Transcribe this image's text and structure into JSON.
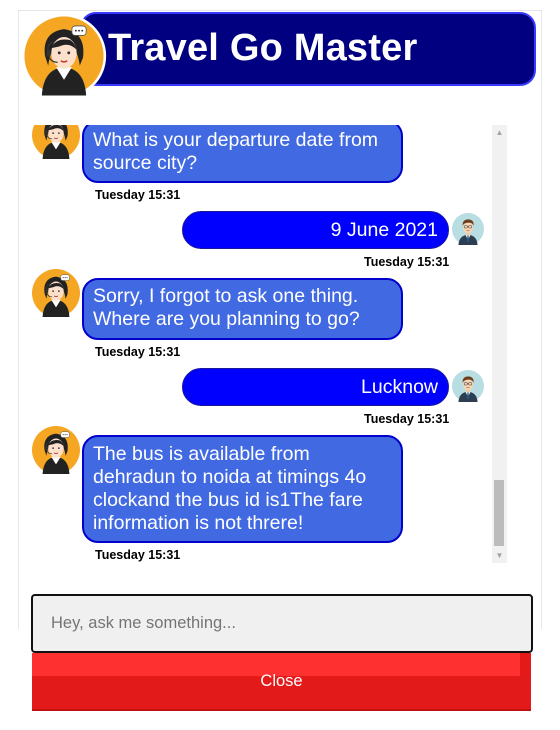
{
  "header": {
    "title": "Travel Go Master"
  },
  "icons": {
    "bot_avatar": "woman-support-agent-icon",
    "user_avatar": "man-user-icon"
  },
  "colors": {
    "header_bg": "#000080",
    "bot_bubble": "#4169e1",
    "user_bubble": "#0000ff",
    "close_button": "#e31a1a"
  },
  "messages": [
    {
      "sender": "bot",
      "text": "What is your departure date from source city?",
      "time": "Tuesday 15:31"
    },
    {
      "sender": "user",
      "text": "9 June 2021",
      "time": "Tuesday 15:31"
    },
    {
      "sender": "bot",
      "text": "Sorry, I forgot to ask one thing. Where are you planning to go?",
      "time": "Tuesday 15:31"
    },
    {
      "sender": "user",
      "text": "Lucknow",
      "time": "Tuesday 15:31"
    },
    {
      "sender": "bot",
      "text": "The bus is available from dehradun to noida at timings 4o clockand the bus id is1The fare information is not threre!",
      "time": "Tuesday 15:31"
    }
  ],
  "input": {
    "placeholder": "Hey, ask me something...",
    "value": ""
  },
  "close_button": {
    "label": "Close"
  }
}
